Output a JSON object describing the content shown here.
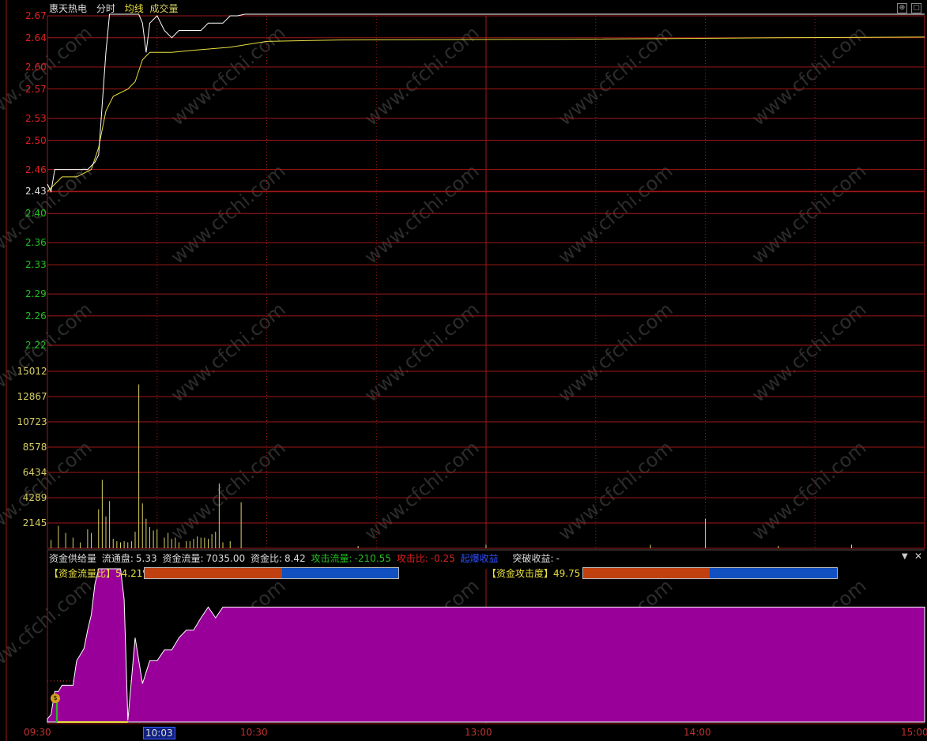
{
  "header": {
    "stock_name": "惠天热电",
    "view": "分时",
    "avg_line": "均线",
    "volume": "成交量"
  },
  "price_axis": [
    "2.67",
    "2.64",
    "2.60",
    "2.57",
    "2.53",
    "2.50",
    "2.46",
    "2.43",
    "2.40",
    "2.36",
    "2.33",
    "2.29",
    "2.26",
    "2.22"
  ],
  "volume_axis": [
    "15012",
    "12867",
    "10723",
    "8578",
    "6434",
    "4289",
    "2145"
  ],
  "info_bar": {
    "title": "资金供给量",
    "float_label": "流通盘:",
    "float_value": "5.33",
    "flow_label": "资金流量:",
    "flow_value": "7035.00",
    "ratio_label": "资金比:",
    "ratio_value": "8.42",
    "attack_flow_label": "攻击流量:",
    "attack_flow_value": "-210.55",
    "attack_ratio_label": "攻击比:",
    "attack_ratio_value": "-0.25",
    "takeoff_label": "起爆收益",
    "breakout_label": "突破收益:",
    "breakout_value": "-"
  },
  "indicators": {
    "flow_ratio_label": "【资金流量比】",
    "flow_ratio_value": "54.21% 买",
    "flow_ratio_fraction": 0.5421,
    "attack_label": "【资金攻击度】",
    "attack_value": "49.75 % 买",
    "attack_fraction": 0.4975
  },
  "time_axis": {
    "t1": "09:30",
    "t2": "10:03",
    "t3": "10:30",
    "t4": "13:00",
    "t5": "14:00",
    "t6": "15:00"
  },
  "watermark": "www.cfchi.com",
  "colors": {
    "grid": "#a01818",
    "price_line": "#ffffff",
    "avg_line": "#e8e040",
    "volume": "#d8d060",
    "fill": "#990099",
    "bar_red": "#c04010",
    "bar_blue": "#1050c0",
    "up": "#e02020",
    "down": "#20c020"
  },
  "chart_data": {
    "type": "line",
    "price": [
      [
        0,
        2.44
      ],
      [
        1,
        2.43
      ],
      [
        2,
        2.46
      ],
      [
        5,
        2.46
      ],
      [
        8,
        2.46
      ],
      [
        11,
        2.46
      ],
      [
        13,
        2.47
      ],
      [
        14,
        2.48
      ],
      [
        15,
        2.55
      ],
      [
        16,
        2.62
      ],
      [
        17,
        2.7
      ],
      [
        19,
        2.72
      ],
      [
        21,
        2.7
      ],
      [
        24,
        2.71
      ],
      [
        25,
        2.72
      ],
      [
        26,
        2.66
      ],
      [
        27,
        2.62
      ],
      [
        28,
        2.66
      ],
      [
        30,
        2.67
      ],
      [
        32,
        2.65
      ],
      [
        34,
        2.64
      ],
      [
        36,
        2.65
      ],
      [
        38,
        2.65
      ],
      [
        40,
        2.65
      ],
      [
        42,
        2.65
      ],
      [
        44,
        2.66
      ],
      [
        46,
        2.66
      ],
      [
        48,
        2.66
      ],
      [
        50,
        2.67
      ],
      [
        52,
        2.67
      ],
      [
        54,
        2.68
      ],
      [
        60,
        2.7
      ],
      [
        240,
        2.7
      ]
    ],
    "avg": [
      [
        0,
        2.43
      ],
      [
        2,
        2.44
      ],
      [
        4,
        2.45
      ],
      [
        8,
        2.45
      ],
      [
        12,
        2.46
      ],
      [
        14,
        2.49
      ],
      [
        16,
        2.54
      ],
      [
        18,
        2.56
      ],
      [
        22,
        2.57
      ],
      [
        24,
        2.58
      ],
      [
        26,
        2.61
      ],
      [
        28,
        2.62
      ],
      [
        34,
        2.62
      ],
      [
        40,
        2.623
      ],
      [
        50,
        2.627
      ],
      [
        60,
        2.635
      ],
      [
        80,
        2.637
      ],
      [
        140,
        2.638
      ],
      [
        200,
        2.64
      ],
      [
        240,
        2.641
      ]
    ],
    "volume": [
      [
        1,
        700
      ],
      [
        3,
        1900
      ],
      [
        5,
        1300
      ],
      [
        7,
        900
      ],
      [
        9,
        500
      ],
      [
        11,
        1600
      ],
      [
        12,
        1300
      ],
      [
        14,
        3300
      ],
      [
        15,
        5800
      ],
      [
        16,
        2700
      ],
      [
        17,
        4000
      ],
      [
        18,
        800
      ],
      [
        19,
        600
      ],
      [
        20,
        500
      ],
      [
        21,
        600
      ],
      [
        22,
        500
      ],
      [
        23,
        600
      ],
      [
        24,
        1400
      ],
      [
        25,
        13900
      ],
      [
        26,
        3800
      ],
      [
        27,
        2500
      ],
      [
        28,
        1800
      ],
      [
        29,
        1500
      ],
      [
        30,
        1600
      ],
      [
        32,
        900
      ],
      [
        33,
        1300
      ],
      [
        34,
        800
      ],
      [
        35,
        900
      ],
      [
        36,
        500
      ],
      [
        38,
        600
      ],
      [
        39,
        600
      ],
      [
        40,
        800
      ],
      [
        41,
        1000
      ],
      [
        42,
        900
      ],
      [
        43,
        900
      ],
      [
        44,
        800
      ],
      [
        45,
        1200
      ],
      [
        46,
        1400
      ],
      [
        47,
        5500
      ],
      [
        48,
        500
      ],
      [
        50,
        600
      ],
      [
        53,
        3900
      ],
      [
        85,
        200
      ],
      [
        120,
        300
      ],
      [
        165,
        300
      ],
      [
        180,
        2500
      ],
      [
        200,
        200
      ],
      [
        220,
        300
      ]
    ],
    "flow": [
      [
        0,
        0.02
      ],
      [
        1,
        0.05
      ],
      [
        2,
        0.2
      ],
      [
        3,
        0.2
      ],
      [
        4,
        0.24
      ],
      [
        6,
        0.24
      ],
      [
        7,
        0.24
      ],
      [
        8,
        0.4
      ],
      [
        10,
        0.48
      ],
      [
        11,
        0.6
      ],
      [
        12,
        0.7
      ],
      [
        13,
        0.9
      ],
      [
        14,
        1.05
      ],
      [
        15,
        1.1
      ],
      [
        16,
        1.1
      ],
      [
        17,
        1.05
      ],
      [
        18,
        1.0
      ],
      [
        20,
        1.0
      ],
      [
        21,
        0.8
      ],
      [
        22,
        0.01
      ],
      [
        24,
        0.55
      ],
      [
        26,
        0.25
      ],
      [
        28,
        0.4
      ],
      [
        30,
        0.4
      ],
      [
        32,
        0.47
      ],
      [
        34,
        0.47
      ],
      [
        36,
        0.55
      ],
      [
        38,
        0.6
      ],
      [
        40,
        0.6
      ],
      [
        42,
        0.68
      ],
      [
        44,
        0.75
      ],
      [
        46,
        0.68
      ],
      [
        48,
        0.75
      ],
      [
        240,
        0.75
      ]
    ],
    "price_range": [
      2.22,
      2.67
    ],
    "volume_max": 15012,
    "minutes_total": 240,
    "grid": true
  }
}
